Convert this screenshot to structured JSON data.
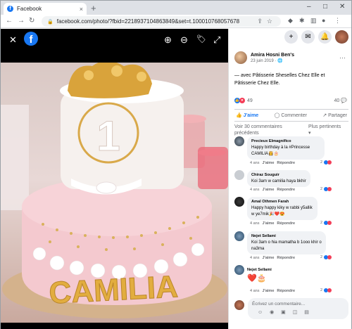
{
  "browser": {
    "tab_title": "Facebook",
    "tab_close": "×",
    "new_tab": "+",
    "url": "facebook.com/photo/?fbid=2218937104863849&set=t.100010768057678",
    "window_controls": [
      "–",
      "□",
      "✕"
    ]
  },
  "viewer": {
    "close": "✕",
    "logo": "f",
    "zoom_in": "⊕",
    "zoom_out": "⊖",
    "tag": "🏷",
    "fullscreen": "⤢"
  },
  "cake": {
    "text": "CAMILIA",
    "number": "1"
  },
  "post": {
    "author": "Amira Hosni Ben's",
    "date": "23 juin 2019 · ",
    "caption": "— avec Pâtisserie Sheselles Chez Elle et Pâtisserie Chez Elle.",
    "reaction_count": "49",
    "comment_count": "40",
    "like_label": "J'aime",
    "comment_label": "Commenter",
    "share_label": "Partager",
    "view_previous": "Voir 30 commentaires précédents",
    "sort_label": "Plus pertinents ▾"
  },
  "comments": [
    {
      "name": "Precieux Elmagnifico",
      "text": "Happy birthday à la #Princesse CAMILIA👸🎂",
      "time": "4 ans",
      "like": "J'aime",
      "reply": "Répondre",
      "count": "2"
    },
    {
      "name": "Chiraz Souguir",
      "text": "Koi 3am w camilia haya bkhir",
      "time": "4 ans",
      "like": "J'aime",
      "reply": "Répondre",
      "count": "2"
    },
    {
      "name": "Amal Othmen Farah",
      "text": "Happy happy kiky w rabbi y5allik w ye7mik🎉❤️😍",
      "time": "4 ans",
      "like": "J'aime",
      "reply": "Répondre",
      "count": "2"
    },
    {
      "name": "Nejet Sellami",
      "text": "Koi 3am o hia mamatha b 1ooo khir o na3ma",
      "time": "4 ans",
      "like": "J'aime",
      "reply": "Répondre",
      "count": "2"
    },
    {
      "name": "Nejet Sellami",
      "text": "❤️🎂",
      "time": "4 ans",
      "like": "J'aime",
      "reply": "Répondre",
      "count": "2"
    }
  ],
  "compose": {
    "placeholder": "Écrivez un commentaire...",
    "icons": "☺ ◉ ▣ ◫ ▤"
  }
}
